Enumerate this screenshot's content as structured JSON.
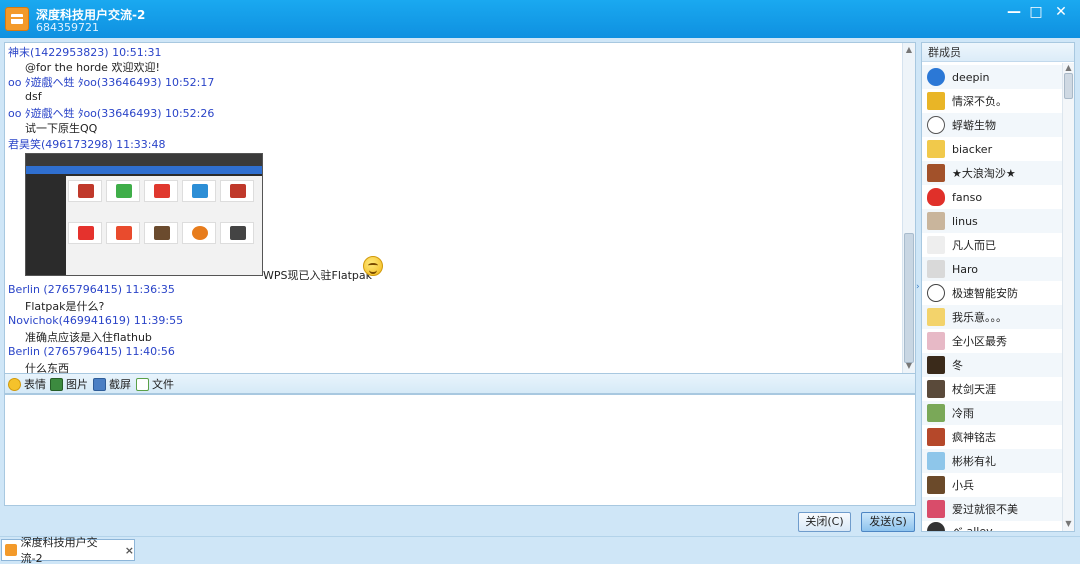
{
  "window": {
    "title": "深度科技用户交流-2",
    "subtitle": "684359721",
    "controls": [
      "—",
      "□",
      "✕"
    ]
  },
  "messages": [
    {
      "head": "神末(1422953823) 10:51:31",
      "body": "@for the horde  欢迎欢迎!"
    },
    {
      "head": "oo ﾀ遊戲ヘ甡 ﾀoo(33646493) 10:52:17",
      "body": "dsf"
    },
    {
      "head": "oo ﾀ遊戲ヘ甡 ﾀoo(33646493) 10:52:26",
      "body": "试一下原生QQ"
    },
    {
      "head": "君昊笑(496173298) 11:33:48",
      "body": "WPS现已入驻Flatpak"
    },
    {
      "head": "Berlin (2765796415) 11:36:35",
      "body": "Flatpak是什么?"
    },
    {
      "head": "Novichok(469941619) 11:39:55",
      "body": "准确点应该是入住flathub"
    },
    {
      "head": "Berlin (2765796415) 11:40:56",
      "body": "什么东西"
    }
  ],
  "toolbar": {
    "emoji": "表情",
    "image": "图片",
    "screenshot": "截屏",
    "file": "文件"
  },
  "buttons": {
    "close": "关闭(C)",
    "send": "发送(S)"
  },
  "members_panel": {
    "title": "群成员",
    "members": [
      "deepin",
      "情深不负。",
      "蜉蝣生物",
      "biacker",
      "★大浪淘沙★",
      "fanso",
      "linus",
      "凡人而已",
      "Haro",
      "极速智能安防",
      "我乐意。。。",
      "全小区最秀",
      "冬",
      "杖剑天涯",
      "冷雨",
      "疯神铭志",
      "彬彬有礼",
      "小兵",
      "爱过就很不美",
      "べ alley"
    ]
  },
  "taskbar": {
    "tab_label": "深度科技用户交流-2",
    "tab_close": "×"
  },
  "colors": {
    "titlebar": "#1aa9f0",
    "username": "#2a44c8",
    "accent": "#f39a2a"
  }
}
